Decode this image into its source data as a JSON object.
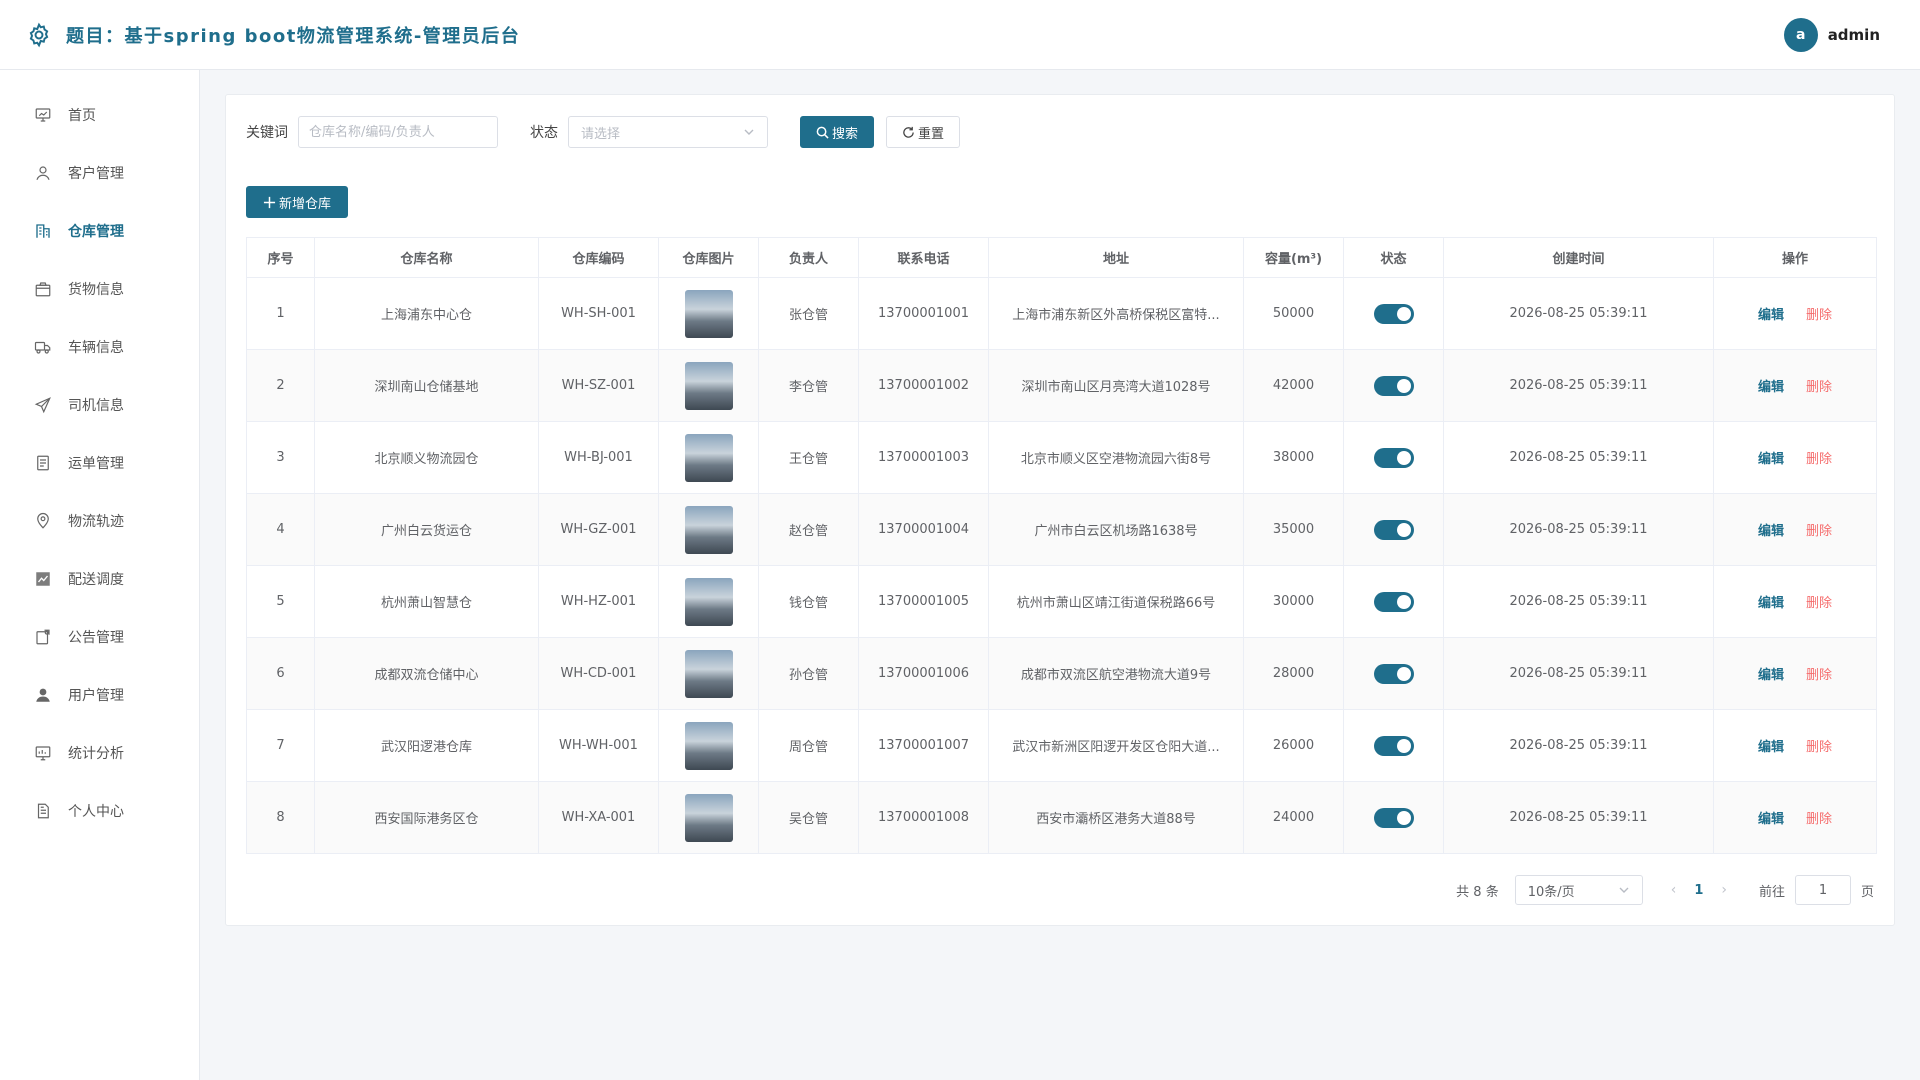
{
  "header": {
    "title": "题目：基于spring boot物流管理系统-管理员后台",
    "avatar_letter": "a",
    "username": "admin"
  },
  "sidebar": {
    "items": [
      {
        "label": "首页",
        "icon": "dashboard-icon"
      },
      {
        "label": "客户管理",
        "icon": "user-icon"
      },
      {
        "label": "仓库管理",
        "icon": "warehouse-icon",
        "active": true
      },
      {
        "label": "货物信息",
        "icon": "package-icon"
      },
      {
        "label": "车辆信息",
        "icon": "truck-icon"
      },
      {
        "label": "司机信息",
        "icon": "send-icon"
      },
      {
        "label": "运单管理",
        "icon": "document-icon"
      },
      {
        "label": "物流轨迹",
        "icon": "location-icon"
      },
      {
        "label": "配送调度",
        "icon": "chart-icon"
      },
      {
        "label": "公告管理",
        "icon": "notice-icon"
      },
      {
        "label": "用户管理",
        "icon": "person-icon"
      },
      {
        "label": "统计分析",
        "icon": "stats-icon"
      },
      {
        "label": "个人中心",
        "icon": "profile-doc-icon"
      }
    ]
  },
  "filters": {
    "keyword_label": "关键词",
    "keyword_placeholder": "仓库名称/编码/负责人",
    "status_label": "状态",
    "status_placeholder": "请选择",
    "search_label": "搜索",
    "reset_label": "重置"
  },
  "add_button_label": "新增仓库",
  "table": {
    "headers": [
      "序号",
      "仓库名称",
      "仓库编码",
      "仓库图片",
      "负责人",
      "联系电话",
      "地址",
      "容量(m³)",
      "状态",
      "创建时间",
      "操作"
    ],
    "rows": [
      {
        "no": "1",
        "name": "上海浦东中心仓",
        "code": "WH-SH-001",
        "manager": "张仓管",
        "phone": "13700001001",
        "address": "上海市浦东新区外高桥保税区富特...",
        "capacity": "50000",
        "enabled": true,
        "created": "2026-08-25 05:39:11"
      },
      {
        "no": "2",
        "name": "深圳南山仓储基地",
        "code": "WH-SZ-001",
        "manager": "李仓管",
        "phone": "13700001002",
        "address": "深圳市南山区月亮湾大道1028号",
        "capacity": "42000",
        "enabled": true,
        "created": "2026-08-25 05:39:11"
      },
      {
        "no": "3",
        "name": "北京顺义物流园仓",
        "code": "WH-BJ-001",
        "manager": "王仓管",
        "phone": "13700001003",
        "address": "北京市顺义区空港物流园六街8号",
        "capacity": "38000",
        "enabled": true,
        "created": "2026-08-25 05:39:11"
      },
      {
        "no": "4",
        "name": "广州白云货运仓",
        "code": "WH-GZ-001",
        "manager": "赵仓管",
        "phone": "13700001004",
        "address": "广州市白云区机场路1638号",
        "capacity": "35000",
        "enabled": true,
        "created": "2026-08-25 05:39:11"
      },
      {
        "no": "5",
        "name": "杭州萧山智慧仓",
        "code": "WH-HZ-001",
        "manager": "钱仓管",
        "phone": "13700001005",
        "address": "杭州市萧山区靖江街道保税路66号",
        "capacity": "30000",
        "enabled": true,
        "created": "2026-08-25 05:39:11"
      },
      {
        "no": "6",
        "name": "成都双流仓储中心",
        "code": "WH-CD-001",
        "manager": "孙仓管",
        "phone": "13700001006",
        "address": "成都市双流区航空港物流大道9号",
        "capacity": "28000",
        "enabled": true,
        "created": "2026-08-25 05:39:11"
      },
      {
        "no": "7",
        "name": "武汉阳逻港仓库",
        "code": "WH-WH-001",
        "manager": "周仓管",
        "phone": "13700001007",
        "address": "武汉市新洲区阳逻开发区仓阳大道...",
        "capacity": "26000",
        "enabled": true,
        "created": "2026-08-25 05:39:11"
      },
      {
        "no": "8",
        "name": "西安国际港务区仓",
        "code": "WH-XA-001",
        "manager": "吴仓管",
        "phone": "13700001008",
        "address": "西安市灞桥区港务大道88号",
        "capacity": "24000",
        "enabled": true,
        "created": "2026-08-25 05:39:11"
      }
    ],
    "edit_label": "编辑",
    "delete_label": "删除"
  },
  "pagination": {
    "total_text": "共 8 条",
    "page_size": "10条/页",
    "current_page": "1",
    "goto_label": "前往",
    "goto_value": "1",
    "page_suffix": "页"
  },
  "colors": {
    "primary": "#1f6e8c",
    "danger": "#f56c6c"
  }
}
